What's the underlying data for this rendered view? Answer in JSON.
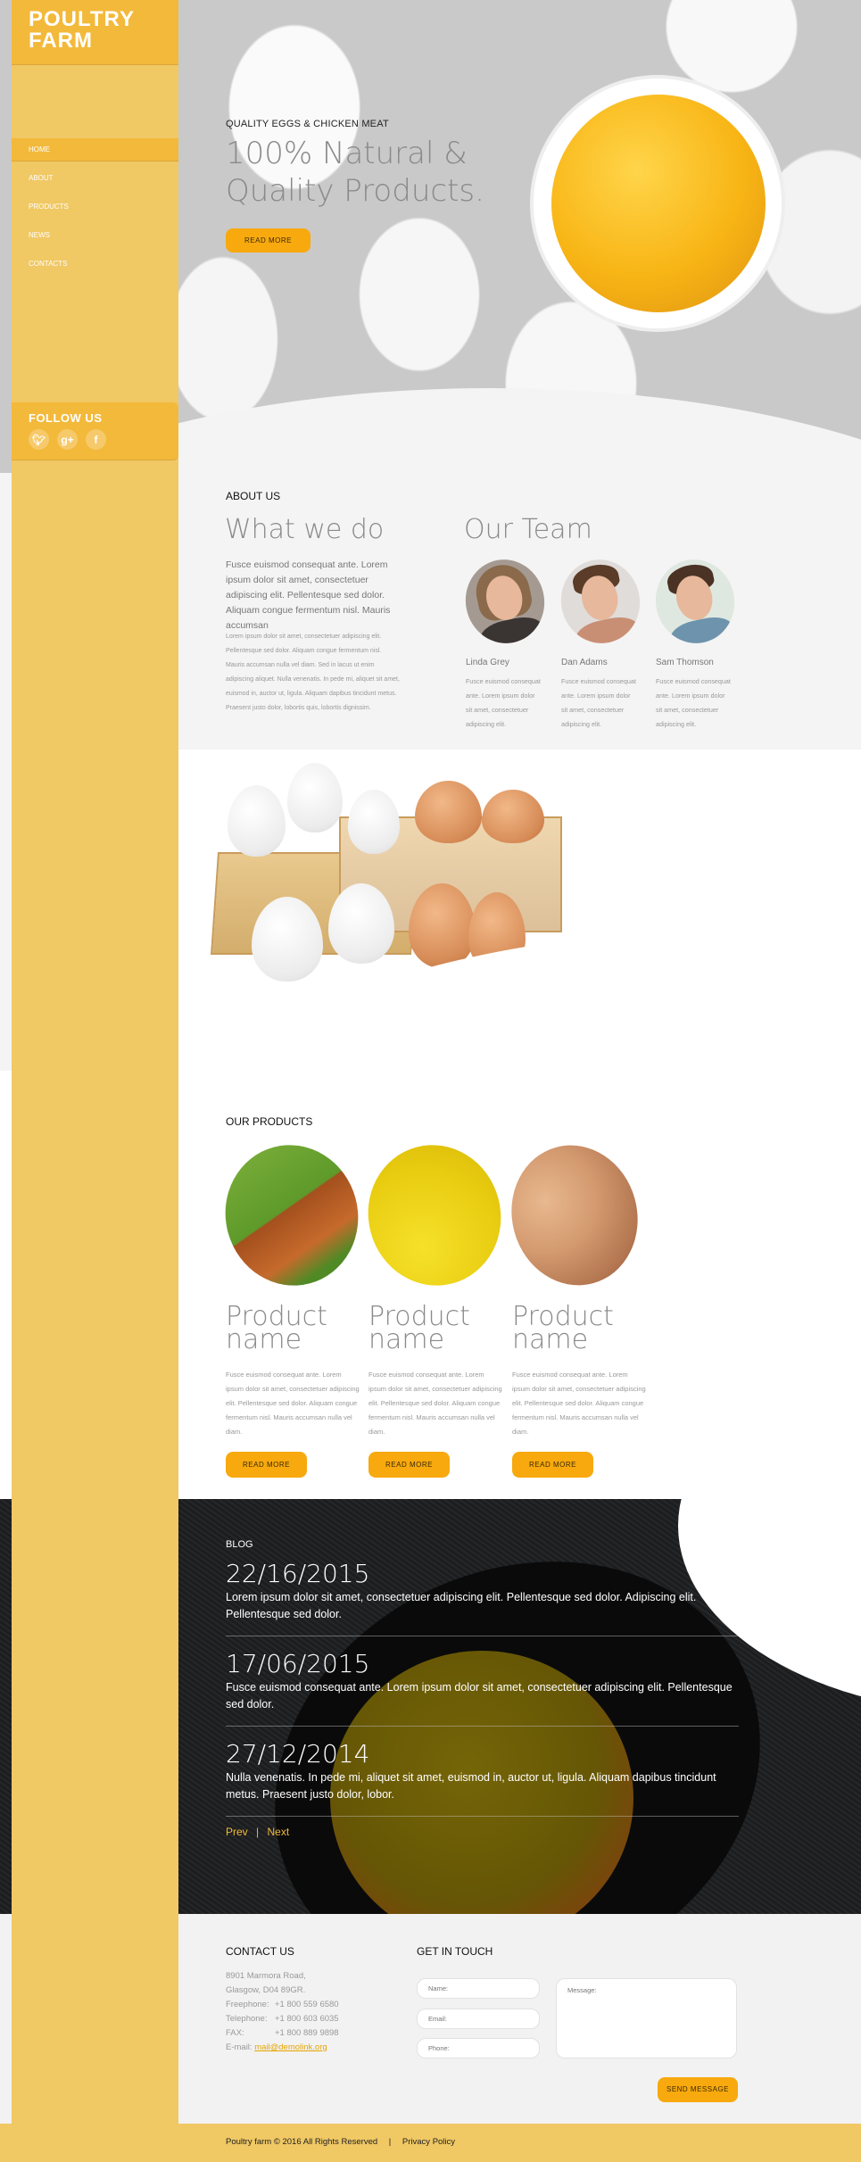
{
  "brand": {
    "line1": "POULTRY",
    "line2": "FARM"
  },
  "nav": [
    {
      "label": "HOME",
      "active": true
    },
    {
      "label": "ABOUT",
      "active": false
    },
    {
      "label": "PRODUCTS",
      "active": false
    },
    {
      "label": "NEWS",
      "active": false
    },
    {
      "label": "CONTACTS",
      "active": false
    }
  ],
  "follow": {
    "title": "FOLLOW US",
    "icons": [
      "twitter-icon",
      "google-plus-icon",
      "facebook-icon"
    ],
    "glyphs": [
      "🐦",
      "g+",
      "f"
    ]
  },
  "hero": {
    "subtitle": "QUALITY EGGS & CHICKEN MEAT",
    "title": "100% Natural & Quality Products.",
    "button": "READ MORE"
  },
  "about": {
    "label": "ABOUT US",
    "heading": "What we do",
    "lead": "Fusce euismod consequat ante. Lorem ipsum dolor sit amet, consectetuer adipiscing elit. Pellentesque sed dolor. Aliquam congue fermentum nisl. Mauris accumsan",
    "body": "Lorem ipsum dolor sit amet, consectetuer adipiscing elit. Pellentesque sed dolor. Aliquam congue fermentum nisl. Mauris accumsan nulla vel diam. Sed in lacus ut enim adipiscing aliquet. Nulla venenatis. In pede mi, aliquet sit amet, euismod in, auctor ut, ligula. Aliquam dapibus tincidunt metus. Praesent justo dolor, lobortis quis, lobortis dignissim."
  },
  "team": {
    "heading": "Our Team",
    "members": [
      {
        "name": "Linda Grey",
        "desc": "Fusce euismod consequat ante. Lorem ipsum dolor sit amet, consectetuer adipiscing elit."
      },
      {
        "name": "Dan Adams",
        "desc": "Fusce euismod consequat ante. Lorem ipsum dolor sit amet, consectetuer adipiscing elit."
      },
      {
        "name": "Sam Thomson",
        "desc": "Fusce euismod consequat ante. Lorem ipsum dolor sit amet, consectetuer adipiscing elit."
      }
    ]
  },
  "products": {
    "label": "OUR PRODUCTS",
    "items": [
      {
        "name": "Product name",
        "desc": "Fusce euismod consequat ante. Lorem ipsum dolor sit amet, consectetuer adipiscing elit. Pellentesque sed dolor. Aliquam congue fermentum nisl. Mauris accumsan nulla vel diam.",
        "button": "READ MORE"
      },
      {
        "name": "Product name",
        "desc": "Fusce euismod consequat ante. Lorem ipsum dolor sit amet, consectetuer adipiscing elit. Pellentesque sed dolor. Aliquam congue fermentum nisl. Mauris accumsan nulla vel diam.",
        "button": "READ MORE"
      },
      {
        "name": "Product name",
        "desc": "Fusce euismod consequat ante. Lorem ipsum dolor sit amet, consectetuer adipiscing elit. Pellentesque sed dolor. Aliquam congue fermentum nisl. Mauris accumsan nulla vel diam.",
        "button": "READ MORE"
      }
    ]
  },
  "blog": {
    "label": "BLOG",
    "posts": [
      {
        "date": "22/16/2015",
        "text": "Lorem ipsum dolor sit amet, consectetuer adipiscing elit. Pellentesque sed dolor. Adipiscing elit. Pellentesque sed dolor."
      },
      {
        "date": "17/06/2015",
        "text": "Fusce euismod consequat ante. Lorem ipsum dolor sit amet, consectetuer adipiscing elit. Pellentesque sed dolor."
      },
      {
        "date": "27/12/2014",
        "text": "Nulla venenatis. In pede mi, aliquet sit amet, euismod in, auctor ut, ligula. Aliquam dapibus tincidunt metus. Praesent justo dolor, lobor."
      }
    ],
    "prev": "Prev",
    "separator": "|",
    "next": "Next"
  },
  "contact": {
    "title": "CONTACT US",
    "address1": "8901 Marmora Road,",
    "address2": "Glasgow, D04 89GR.",
    "freephone_label": "Freephone:",
    "freephone": "+1 800 559 6580",
    "telephone_label": "Telephone:",
    "telephone": "+1 800 603 6035",
    "fax_label": "FAX:",
    "fax": "+1 800 889 9898",
    "email_label": "E-mail:",
    "email": "mail@demolink.org"
  },
  "form": {
    "title": "GET IN TOUCH",
    "name_placeholder": "Name:",
    "email_placeholder": "Email:",
    "phone_placeholder": "Phone:",
    "message_placeholder": "Message:",
    "name_value": "",
    "email_value": "",
    "phone_value": "",
    "message_value": "",
    "send": "SEND MESSAGE"
  },
  "footer": {
    "copyright": "Poultry farm © 2016 All Rights Reserved",
    "separator": "|",
    "privacy": "Privacy Policy"
  },
  "colors": {
    "sidebar": "#f0c864",
    "sidebar_active": "#f3b93a",
    "button": "#f8a90e",
    "link": "#e5a500"
  }
}
